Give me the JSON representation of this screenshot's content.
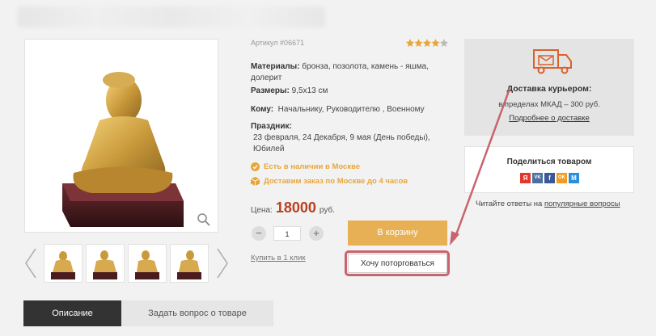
{
  "product": {
    "article": "Артикул #06671",
    "rating": 4,
    "rating_max": 5,
    "materials_label": "Материалы:",
    "materials_value": "бронза, позолота, камень - яшма,",
    "materials_value2": "долерит",
    "size_label": "Размеры:",
    "size_value": "9,5x13 см",
    "for_label": "Кому:",
    "for_value": "Начальнику, Руководителю , Военному",
    "holiday_label": "Праздник:",
    "holiday_line1": "23 февраля, 24 Декабря, 9 мая (День победы),",
    "holiday_line2": "Юбилей",
    "in_stock": "Есть в наличии в Москве",
    "delivery_note": "Доставим заказ по Москве до 4 часов",
    "price_label": "Цена:",
    "price": "18000",
    "currency": "руб.",
    "quantity": "1",
    "buy_one_click": "Купить в 1 клик",
    "cart_button": "В корзину",
    "haggle_button": "Хочу поторговаться"
  },
  "delivery": {
    "title": "Доставка курьером:",
    "text": "в пределах МКАД – 300 руб.",
    "link": "Подробнее о доставке"
  },
  "share": {
    "title": "Поделиться товаром",
    "networks": [
      "Я",
      "VK",
      "f",
      "OK",
      "M"
    ],
    "colors": [
      "#e5362a",
      "#4b6f9f",
      "#3b5998",
      "#f59a1e",
      "#2b8fde"
    ]
  },
  "faq": {
    "prefix": "Читайте ответы на",
    "link": "популярные вопросы"
  },
  "tabs": [
    {
      "label": "Описание"
    },
    {
      "label": "Задать вопрос о товаре"
    }
  ],
  "colors": {
    "accent": "#e7b055",
    "price": "#b9401f",
    "highlight": "#c8646d"
  }
}
